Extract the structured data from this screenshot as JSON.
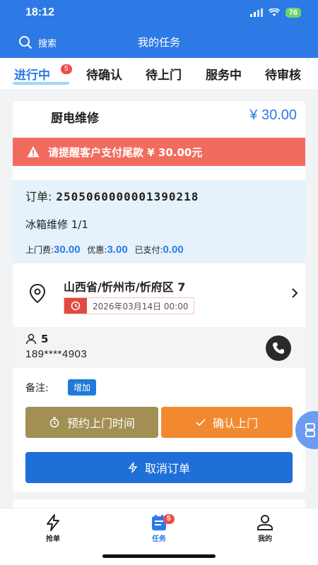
{
  "status_bar": {
    "time": "18:12",
    "battery": "76"
  },
  "nav": {
    "search_label": "搜索",
    "title": "我的任务"
  },
  "tabs": [
    {
      "label": "进行中",
      "badge": "5",
      "active": true
    },
    {
      "label": "待确认"
    },
    {
      "label": "待上门"
    },
    {
      "label": "服务中"
    },
    {
      "label": "待审核"
    }
  ],
  "order": {
    "service_name": "厨电维修",
    "price": "¥ 30.00",
    "alert_text": "请提醒客户支付尾款 ¥ 30.00元",
    "order_label": "订单:",
    "order_no": "2505060000001390218",
    "item": "冰箱维修 1/1",
    "fee_label": "上门费:",
    "fee_value": "30.00",
    "discount_label": "优惠:",
    "discount_value": "3.00",
    "paid_label": "已支付:",
    "paid_value": "0.00",
    "address": "山西省/忻州市/忻府区 7",
    "appointment_time": "2026年03月14日 00:00",
    "contact_name": "5",
    "contact_phone": "189****4903",
    "note_label": "备注:",
    "add_label": "增加",
    "btn_schedule": "预约上门时间",
    "btn_confirm": "确认上门",
    "btn_cancel": "取消订单"
  },
  "bottom_nav": [
    {
      "label": "抢单",
      "icon": "lightning-icon"
    },
    {
      "label": "任务",
      "icon": "task-icon",
      "badge": "5",
      "active": true
    },
    {
      "label": "我的",
      "icon": "user-icon"
    }
  ],
  "colors": {
    "primary": "#2d7ae6",
    "alert": "#f26c5e",
    "schedule_btn": "#a28f53",
    "confirm_btn": "#f2892f",
    "cancel_btn": "#1f6fd8"
  }
}
